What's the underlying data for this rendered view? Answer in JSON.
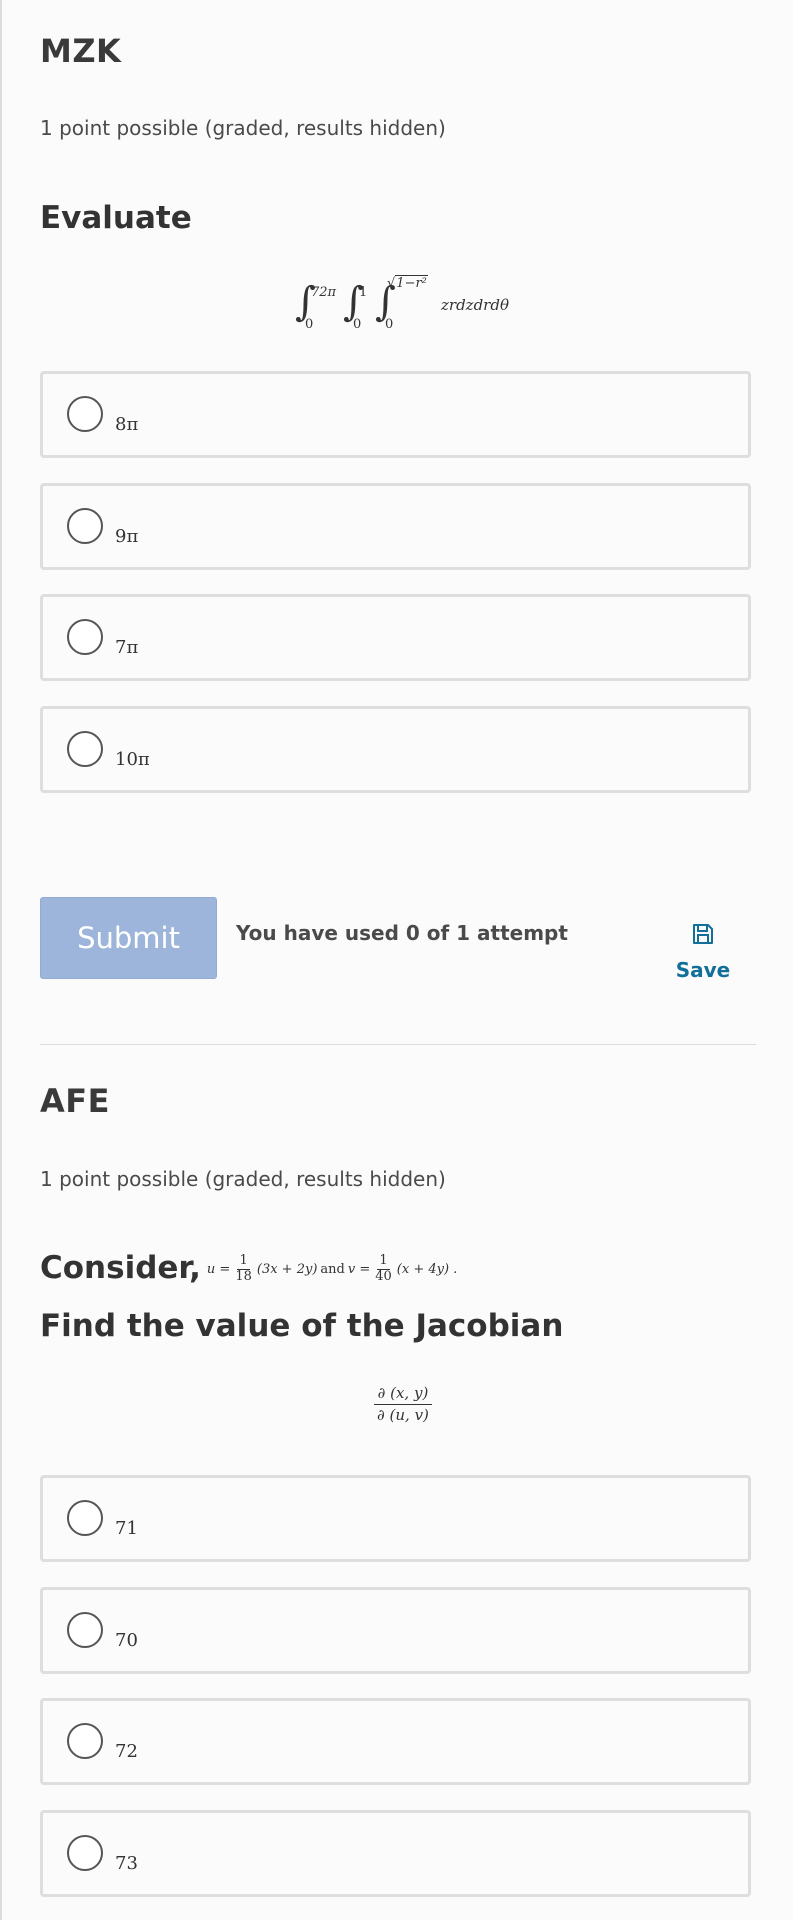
{
  "problems": [
    {
      "title": "MZK",
      "points": "1 point possible (graded, results hidden)",
      "prompt": "Evaluate",
      "formula": {
        "outer_upper": "72π",
        "outer_lower": "0",
        "middle_upper": "1",
        "middle_lower": "0",
        "inner_upper": "1−r²",
        "inner_lower": "0",
        "integrand": "zrdzdrdθ"
      },
      "choices": [
        "8π",
        "9π",
        "7π",
        "10π"
      ]
    },
    {
      "title": "AFE",
      "points": "1 point possible (graded, results hidden)",
      "prompt_prefix": "Consider,",
      "prompt_line2": "Find the value of the Jacobian",
      "definition": {
        "u_lhs": "u =",
        "u_num": "1",
        "u_den": "18",
        "u_rest": "(3x + 2y)",
        "and_word": "and",
        "v_lhs": "v =",
        "v_num": "1",
        "v_den": "40",
        "v_rest": "(x + 4y) ."
      },
      "jacobian": {
        "numerator": "∂ (x, y)",
        "denominator": "∂ (u, v)"
      },
      "choices": [
        "71",
        "70",
        "72",
        "73"
      ]
    }
  ],
  "actions": {
    "submit_label": "Submit",
    "attempts_text": "You have used 0 of 1 attempt",
    "save_label": "Save",
    "save_icon": "floppy-disk-icon"
  },
  "colors": {
    "submit_bg": "#9db5da",
    "save_accent": "#126f9a",
    "choice_border": "#dedede"
  }
}
